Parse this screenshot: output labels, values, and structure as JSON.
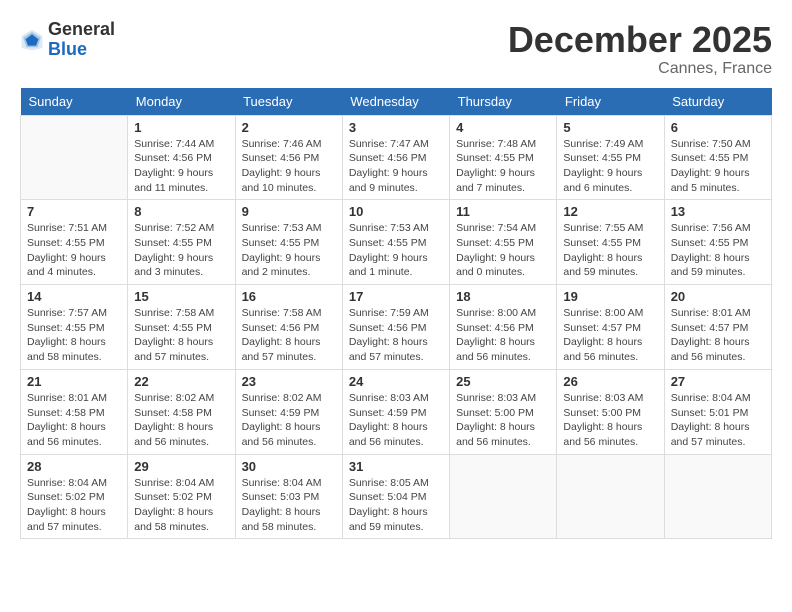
{
  "header": {
    "logo_general": "General",
    "logo_blue": "Blue",
    "title": "December 2025",
    "subtitle": "Cannes, France"
  },
  "calendar": {
    "weekdays": [
      "Sunday",
      "Monday",
      "Tuesday",
      "Wednesday",
      "Thursday",
      "Friday",
      "Saturday"
    ],
    "weeks": [
      [
        {
          "day": "",
          "sunrise": "",
          "sunset": "",
          "daylight": "",
          "empty": true
        },
        {
          "day": "1",
          "sunrise": "Sunrise: 7:44 AM",
          "sunset": "Sunset: 4:56 PM",
          "daylight": "Daylight: 9 hours and 11 minutes.",
          "empty": false
        },
        {
          "day": "2",
          "sunrise": "Sunrise: 7:46 AM",
          "sunset": "Sunset: 4:56 PM",
          "daylight": "Daylight: 9 hours and 10 minutes.",
          "empty": false
        },
        {
          "day": "3",
          "sunrise": "Sunrise: 7:47 AM",
          "sunset": "Sunset: 4:56 PM",
          "daylight": "Daylight: 9 hours and 9 minutes.",
          "empty": false
        },
        {
          "day": "4",
          "sunrise": "Sunrise: 7:48 AM",
          "sunset": "Sunset: 4:55 PM",
          "daylight": "Daylight: 9 hours and 7 minutes.",
          "empty": false
        },
        {
          "day": "5",
          "sunrise": "Sunrise: 7:49 AM",
          "sunset": "Sunset: 4:55 PM",
          "daylight": "Daylight: 9 hours and 6 minutes.",
          "empty": false
        },
        {
          "day": "6",
          "sunrise": "Sunrise: 7:50 AM",
          "sunset": "Sunset: 4:55 PM",
          "daylight": "Daylight: 9 hours and 5 minutes.",
          "empty": false
        }
      ],
      [
        {
          "day": "7",
          "sunrise": "Sunrise: 7:51 AM",
          "sunset": "Sunset: 4:55 PM",
          "daylight": "Daylight: 9 hours and 4 minutes.",
          "empty": false
        },
        {
          "day": "8",
          "sunrise": "Sunrise: 7:52 AM",
          "sunset": "Sunset: 4:55 PM",
          "daylight": "Daylight: 9 hours and 3 minutes.",
          "empty": false
        },
        {
          "day": "9",
          "sunrise": "Sunrise: 7:53 AM",
          "sunset": "Sunset: 4:55 PM",
          "daylight": "Daylight: 9 hours and 2 minutes.",
          "empty": false
        },
        {
          "day": "10",
          "sunrise": "Sunrise: 7:53 AM",
          "sunset": "Sunset: 4:55 PM",
          "daylight": "Daylight: 9 hours and 1 minute.",
          "empty": false
        },
        {
          "day": "11",
          "sunrise": "Sunrise: 7:54 AM",
          "sunset": "Sunset: 4:55 PM",
          "daylight": "Daylight: 9 hours and 0 minutes.",
          "empty": false
        },
        {
          "day": "12",
          "sunrise": "Sunrise: 7:55 AM",
          "sunset": "Sunset: 4:55 PM",
          "daylight": "Daylight: 8 hours and 59 minutes.",
          "empty": false
        },
        {
          "day": "13",
          "sunrise": "Sunrise: 7:56 AM",
          "sunset": "Sunset: 4:55 PM",
          "daylight": "Daylight: 8 hours and 59 minutes.",
          "empty": false
        }
      ],
      [
        {
          "day": "14",
          "sunrise": "Sunrise: 7:57 AM",
          "sunset": "Sunset: 4:55 PM",
          "daylight": "Daylight: 8 hours and 58 minutes.",
          "empty": false
        },
        {
          "day": "15",
          "sunrise": "Sunrise: 7:58 AM",
          "sunset": "Sunset: 4:55 PM",
          "daylight": "Daylight: 8 hours and 57 minutes.",
          "empty": false
        },
        {
          "day": "16",
          "sunrise": "Sunrise: 7:58 AM",
          "sunset": "Sunset: 4:56 PM",
          "daylight": "Daylight: 8 hours and 57 minutes.",
          "empty": false
        },
        {
          "day": "17",
          "sunrise": "Sunrise: 7:59 AM",
          "sunset": "Sunset: 4:56 PM",
          "daylight": "Daylight: 8 hours and 57 minutes.",
          "empty": false
        },
        {
          "day": "18",
          "sunrise": "Sunrise: 8:00 AM",
          "sunset": "Sunset: 4:56 PM",
          "daylight": "Daylight: 8 hours and 56 minutes.",
          "empty": false
        },
        {
          "day": "19",
          "sunrise": "Sunrise: 8:00 AM",
          "sunset": "Sunset: 4:57 PM",
          "daylight": "Daylight: 8 hours and 56 minutes.",
          "empty": false
        },
        {
          "day": "20",
          "sunrise": "Sunrise: 8:01 AM",
          "sunset": "Sunset: 4:57 PM",
          "daylight": "Daylight: 8 hours and 56 minutes.",
          "empty": false
        }
      ],
      [
        {
          "day": "21",
          "sunrise": "Sunrise: 8:01 AM",
          "sunset": "Sunset: 4:58 PM",
          "daylight": "Daylight: 8 hours and 56 minutes.",
          "empty": false
        },
        {
          "day": "22",
          "sunrise": "Sunrise: 8:02 AM",
          "sunset": "Sunset: 4:58 PM",
          "daylight": "Daylight: 8 hours and 56 minutes.",
          "empty": false
        },
        {
          "day": "23",
          "sunrise": "Sunrise: 8:02 AM",
          "sunset": "Sunset: 4:59 PM",
          "daylight": "Daylight: 8 hours and 56 minutes.",
          "empty": false
        },
        {
          "day": "24",
          "sunrise": "Sunrise: 8:03 AM",
          "sunset": "Sunset: 4:59 PM",
          "daylight": "Daylight: 8 hours and 56 minutes.",
          "empty": false
        },
        {
          "day": "25",
          "sunrise": "Sunrise: 8:03 AM",
          "sunset": "Sunset: 5:00 PM",
          "daylight": "Daylight: 8 hours and 56 minutes.",
          "empty": false
        },
        {
          "day": "26",
          "sunrise": "Sunrise: 8:03 AM",
          "sunset": "Sunset: 5:00 PM",
          "daylight": "Daylight: 8 hours and 56 minutes.",
          "empty": false
        },
        {
          "day": "27",
          "sunrise": "Sunrise: 8:04 AM",
          "sunset": "Sunset: 5:01 PM",
          "daylight": "Daylight: 8 hours and 57 minutes.",
          "empty": false
        }
      ],
      [
        {
          "day": "28",
          "sunrise": "Sunrise: 8:04 AM",
          "sunset": "Sunset: 5:02 PM",
          "daylight": "Daylight: 8 hours and 57 minutes.",
          "empty": false
        },
        {
          "day": "29",
          "sunrise": "Sunrise: 8:04 AM",
          "sunset": "Sunset: 5:02 PM",
          "daylight": "Daylight: 8 hours and 58 minutes.",
          "empty": false
        },
        {
          "day": "30",
          "sunrise": "Sunrise: 8:04 AM",
          "sunset": "Sunset: 5:03 PM",
          "daylight": "Daylight: 8 hours and 58 minutes.",
          "empty": false
        },
        {
          "day": "31",
          "sunrise": "Sunrise: 8:05 AM",
          "sunset": "Sunset: 5:04 PM",
          "daylight": "Daylight: 8 hours and 59 minutes.",
          "empty": false
        },
        {
          "day": "",
          "sunrise": "",
          "sunset": "",
          "daylight": "",
          "empty": true
        },
        {
          "day": "",
          "sunrise": "",
          "sunset": "",
          "daylight": "",
          "empty": true
        },
        {
          "day": "",
          "sunrise": "",
          "sunset": "",
          "daylight": "",
          "empty": true
        }
      ]
    ]
  }
}
